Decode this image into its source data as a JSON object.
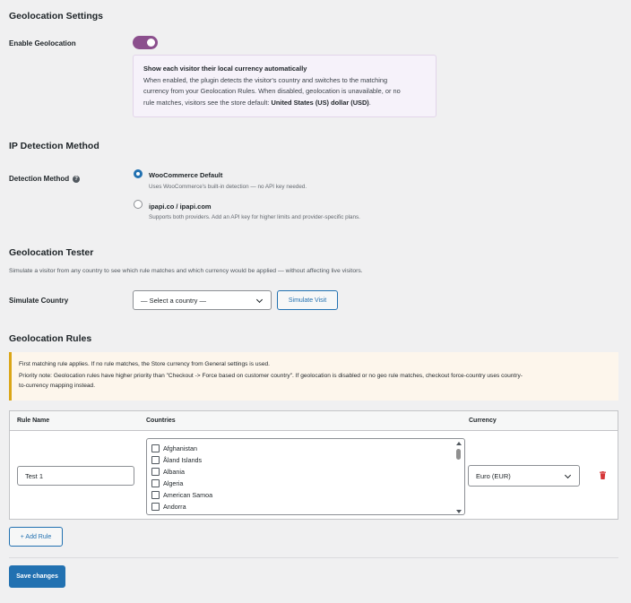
{
  "sections": {
    "geolocation_settings": "Geolocation Settings",
    "ip_detection": "IP Detection Method",
    "tester": "Geolocation Tester",
    "rules": "Geolocation Rules"
  },
  "enable_geolocation": {
    "label": "Enable Geolocation",
    "enabled": true,
    "toggle_color": "#8b4f8d",
    "info_title": "Show each visitor their local currency automatically",
    "info_line1": "When enabled, the plugin detects the visitor's country and switches to the matching",
    "info_line2": "currency from your Geolocation Rules. When disabled, geolocation is unavailable, or no",
    "info_line3_prefix": "rule matches, visitors see the store default: ",
    "info_default_currency": "United States (US) dollar (USD)",
    "info_line3_suffix": "."
  },
  "detection": {
    "label": "Detection Method",
    "help_icon": "question-circle-icon",
    "options": [
      {
        "title": "WooCommerce Default",
        "desc": "Uses WooCommerce's built-in detection — no API key needed.",
        "checked": true
      },
      {
        "title": "ipapi.co / ipapi.com",
        "desc": "Supports both providers. Add an API key for higher limits and provider-specific plans.",
        "checked": false
      }
    ]
  },
  "tester": {
    "description": "Simulate a visitor from any country to see which rule matches and which currency would be applied — without affecting live visitors.",
    "label": "Simulate Country",
    "select_value": "— Select a country —",
    "button": "Simulate Visit"
  },
  "rules": {
    "notice_line1": "First matching rule applies. If no rule matches, the Store currency from General settings is used.",
    "notice_line2": "Priority note: Geolocation rules have higher priority than \"Checkout -> Force based on customer country\". If geolocation is disabled or no geo rule matches, checkout force-country uses country-",
    "notice_line3": "to-currency mapping instead.",
    "headers": {
      "rule_name": "Rule Name",
      "countries": "Countries",
      "currency": "Currency"
    },
    "rows": [
      {
        "rule_name": "Test 1",
        "countries": [
          "Afghanistan",
          "Åland Islands",
          "Albania",
          "Algeria",
          "American Samoa",
          "Andorra"
        ],
        "currency": "Euro (EUR)",
        "delete_icon": "trash-icon"
      }
    ],
    "add_button": "+ Add Rule"
  },
  "save_button": "Save changes",
  "colors": {
    "primary": "#2271b1",
    "danger": "#d63638",
    "notice_border": "#dba617"
  }
}
